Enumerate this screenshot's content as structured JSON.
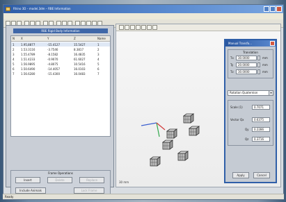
{
  "window": {
    "title": "Rhino 3D – model.3dm – RBE Information",
    "menu": []
  },
  "left_panel": {
    "title": "RBE Rigid Body Information",
    "table": {
      "headers": [
        "N",
        "X",
        "Y",
        "Z",
        "Name"
      ],
      "rows": [
        [
          "1",
          "1.95,8877",
          "-15.4127",
          "15.5427",
          "1"
        ],
        [
          "2",
          "1.53.3116",
          "-3.7546",
          "8.3817",
          "2"
        ],
        [
          "3",
          "1.55.4789",
          "-8.1582",
          "16.4835",
          "3"
        ],
        [
          "4",
          "1.51.4233",
          "-0.9070",
          "61.6027",
          "4"
        ],
        [
          "5",
          "1.56.9895",
          "-4.8075",
          "10.5416",
          "5"
        ],
        [
          "6",
          "1.50.6490",
          "-14.4057",
          "16.0103",
          "6"
        ],
        [
          "7",
          "1.56.6280",
          "-15.4300",
          "16.0483",
          "7"
        ]
      ]
    },
    "group": {
      "title": "Frame Operations",
      "buttons": [
        {
          "label": "Insert",
          "enabled": true
        },
        {
          "label": "Delete",
          "enabled": false
        },
        {
          "label": "Replace",
          "enabled": false
        },
        {
          "label": "Include Animals",
          "enabled": true
        },
        {
          "label": "Lock Frame",
          "enabled": false
        }
      ]
    }
  },
  "viewport": {
    "scale_label": "30 mm"
  },
  "dialog": {
    "title": "Manual Transfo...",
    "translation": {
      "title": "Translation",
      "fields": [
        {
          "label": "Tx",
          "value": "30.0000",
          "unit": "mm"
        },
        {
          "label": "Ty",
          "value": "20.0000",
          "unit": "mm"
        },
        {
          "label": "Tz",
          "value": "30.0000",
          "unit": "mm"
        }
      ]
    },
    "rotation_select": "Rotation Quaternion",
    "rotation": {
      "scale_label": "Scale (1)",
      "scale_value": "0.7071",
      "vector_label": "Vector Qx",
      "vector_value": "0.6375",
      "qy_label": "Qy",
      "qy_value": "0.2286",
      "qz_label": "Qz",
      "qz_value": "0.3716"
    },
    "buttons": {
      "apply": "Apply",
      "cancel": "Cancel"
    }
  },
  "status": {
    "text": "Ready"
  },
  "colors": {
    "title_bar": "#2f5ea8",
    "panel_title": "#3f67a8",
    "axis_x": "#d23b3b",
    "axis_y": "#2fa84a",
    "axis_z": "#3a5fcf"
  }
}
